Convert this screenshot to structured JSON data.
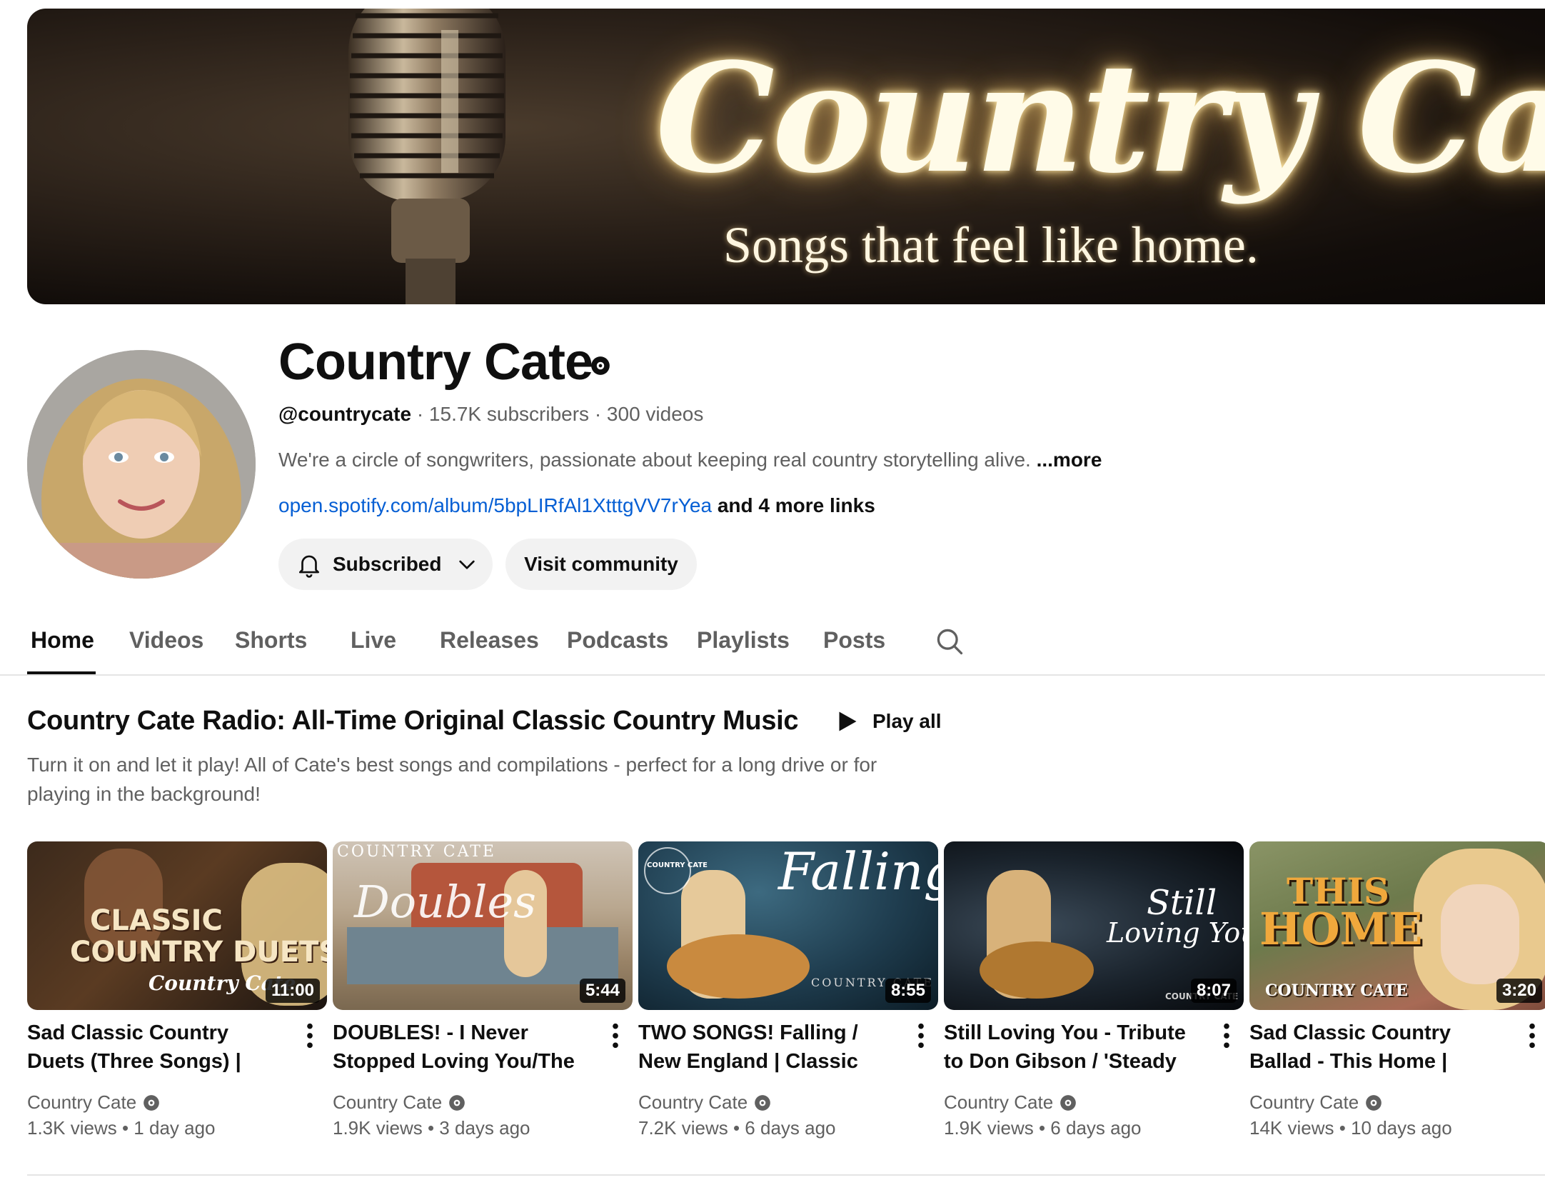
{
  "banner": {
    "title": "Country Cate",
    "subtitle": "Songs that feel like home."
  },
  "channel": {
    "name": "Country Cate",
    "handle": "@countrycate",
    "subscribers": "15.7K subscribers",
    "videos": "300 videos",
    "description": "We're a circle of songwriters, passionate about keeping real country storytelling alive.",
    "more_label": "...more",
    "link": "open.spotify.com/album/5bpLIRfAl1XtttgVV7rYea",
    "more_links": "and 4 more links",
    "subscribed_label": "Subscribed",
    "community_label": "Visit community"
  },
  "tabs": [
    {
      "label": "Home",
      "active": true
    },
    {
      "label": "Videos"
    },
    {
      "label": "Shorts"
    },
    {
      "label": "Live"
    },
    {
      "label": "Releases"
    },
    {
      "label": "Podcasts"
    },
    {
      "label": "Playlists"
    },
    {
      "label": "Posts"
    }
  ],
  "section": {
    "title": "Country Cate Radio: All-Time Original Classic Country Music",
    "play_all": "Play all",
    "description": "Turn it on and let it play! All of Cate's best songs and compilations - perfect for a long drive or for playing in the background!"
  },
  "videos": [
    {
      "title": "Sad Classic Country Duets (Three Songs) | Country Cate",
      "channel": "Country Cate",
      "views": "1.3K views",
      "age": "1 day ago",
      "duration": "11:00",
      "thumb_lines": [
        "CLASSIC",
        "COUNTRY DUETS",
        "Country Cate"
      ]
    },
    {
      "title": "DOUBLES! - I Never Stopped Loving You/The Bottle |...",
      "channel": "Country Cate",
      "views": "1.9K views",
      "age": "3 days ago",
      "duration": "5:44",
      "thumb_lines": [
        "COUNTRY CATE",
        "Doubles"
      ]
    },
    {
      "title": "TWO SONGS! Falling / New England | Classic Country",
      "channel": "Country Cate",
      "views": "7.2K views",
      "age": "6 days ago",
      "duration": "8:55",
      "thumb_lines": [
        "Falling",
        "COUNTRY CATE",
        "COUNTRY CATE"
      ]
    },
    {
      "title": "Still Loving You - Tribute to Don Gibson / 'Steady as the...",
      "channel": "Country Cate",
      "views": "1.9K views",
      "age": "6 days ago",
      "duration": "8:07",
      "thumb_lines": [
        "Still",
        "Loving You",
        "COUNTRY CATE"
      ]
    },
    {
      "title": "Sad Classic Country Ballad - This Home | Country Cate",
      "channel": "Country Cate",
      "views": "14K views",
      "age": "10 days ago",
      "duration": "3:20",
      "thumb_lines": [
        "THIS",
        "HOME",
        "COUNTRY CATE"
      ]
    }
  ],
  "colors": {
    "link": "#065fd4",
    "secondary_text": "#606060",
    "button_bg": "#f2f2f2"
  }
}
